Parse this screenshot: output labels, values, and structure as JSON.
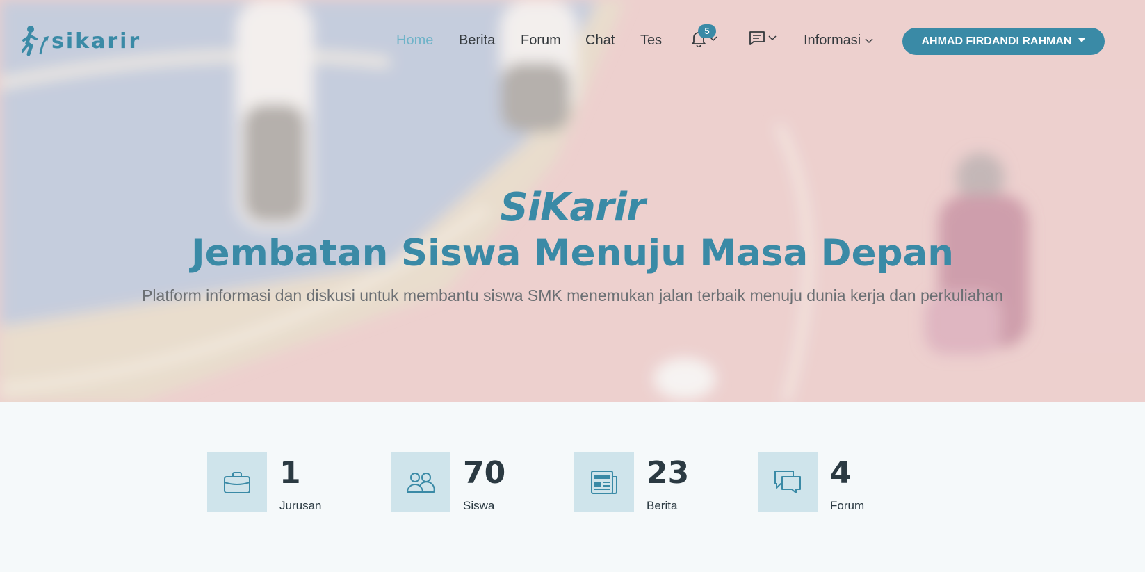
{
  "brand": {
    "name": "sikarir",
    "color": "#3a8aa6"
  },
  "nav": {
    "items": [
      {
        "label": "Home",
        "active": true
      },
      {
        "label": "Berita"
      },
      {
        "label": "Forum"
      },
      {
        "label": "Chat"
      },
      {
        "label": "Tes"
      }
    ],
    "notifications": {
      "icon": "bell-icon",
      "count": "5"
    },
    "messages": {
      "icon": "message-icon"
    },
    "info": {
      "label": "Informasi"
    },
    "user": {
      "label": "AHMAD FIRDANDI RAHMAN"
    }
  },
  "hero": {
    "title": "SiKarir",
    "subtitle": "Jembatan Siswa Menuju Masa Depan",
    "description": "Platform informasi dan diskusi untuk membantu siswa SMK menemukan jalan terbaik menuju dunia kerja dan perkuliahan"
  },
  "stats": [
    {
      "icon": "briefcase-icon",
      "value": "1",
      "label": "Jurusan"
    },
    {
      "icon": "users-icon",
      "value": "70",
      "label": "Siswa"
    },
    {
      "icon": "newspaper-icon",
      "value": "23",
      "label": "Berita"
    },
    {
      "icon": "chat-icon",
      "value": "4",
      "label": "Forum"
    }
  ]
}
